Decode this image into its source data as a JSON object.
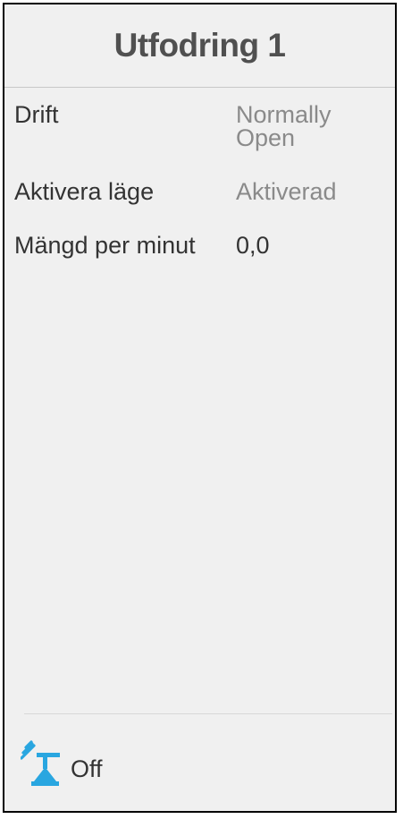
{
  "header": {
    "title": "Utfodring 1"
  },
  "settings": [
    {
      "label": "Drift",
      "value": "Normally Open"
    },
    {
      "label": "Aktivera läge",
      "value": "Aktiverad"
    },
    {
      "label": "Mängd per minut",
      "value": "0,0"
    }
  ],
  "footer": {
    "icon": "feeder-icon",
    "status": "Off"
  },
  "colors": {
    "icon_blue": "#29a6e0",
    "text_dark": "#333333",
    "text_muted": "#8a8a8a",
    "background": "#f0f0f0"
  }
}
